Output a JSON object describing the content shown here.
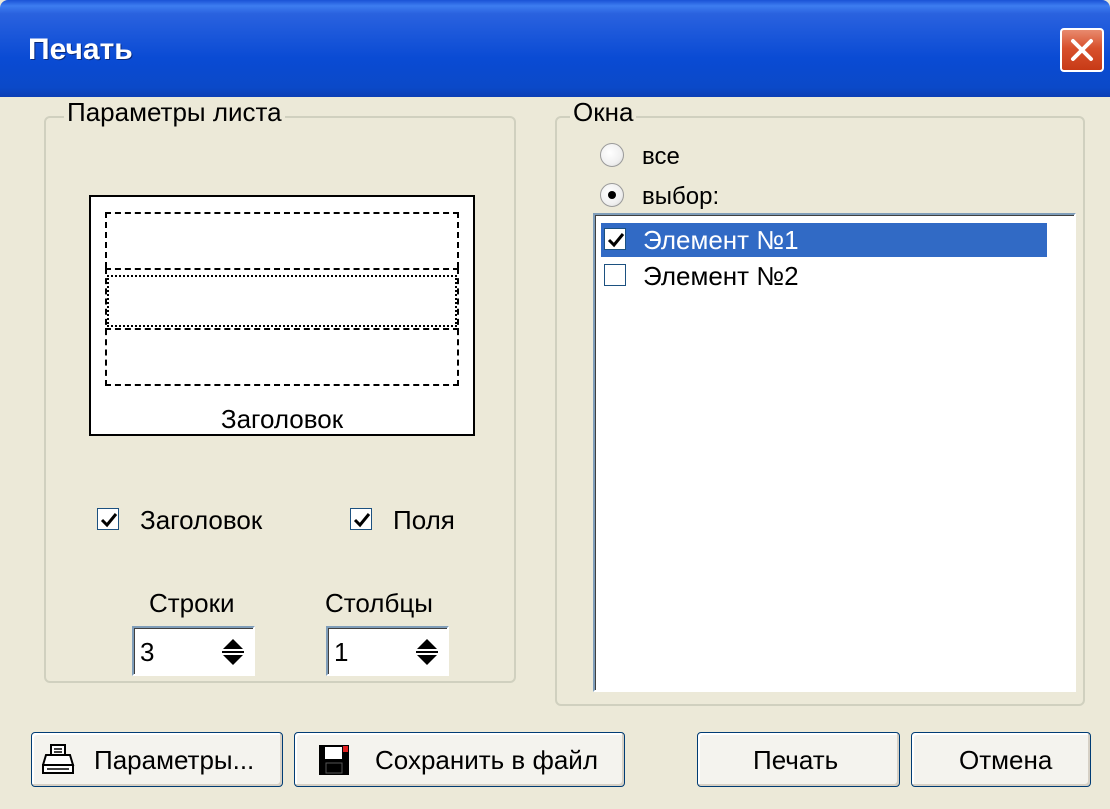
{
  "window": {
    "title": "Печать"
  },
  "sheet_params": {
    "group_label": "Параметры листа",
    "preview_caption": "Заголовок",
    "header_checkbox": {
      "label": "Заголовок",
      "checked": true
    },
    "margins_checkbox": {
      "label": "Поля",
      "checked": true
    },
    "rows": {
      "label": "Строки",
      "value": "3"
    },
    "columns": {
      "label": "Столбцы",
      "value": "1"
    }
  },
  "windows": {
    "group_label": "Окна",
    "radio_all": {
      "label": "все",
      "selected": false
    },
    "radio_selection": {
      "label": "выбор:",
      "selected": true
    },
    "items": [
      {
        "label": "Элемент №1",
        "checked": true,
        "selected": true
      },
      {
        "label": "Элемент №2",
        "checked": false,
        "selected": false
      }
    ]
  },
  "buttons": {
    "params": "Параметры...",
    "save": "Сохранить в файл",
    "print": "Печать",
    "cancel": "Отмена"
  },
  "icons": {
    "close": "close-icon",
    "printer": "printer-icon",
    "floppy": "floppy-disk-icon"
  },
  "colors": {
    "titlebar": "#0a4bd4",
    "dialog_bg": "#ece9d8",
    "selection": "#316ac5",
    "close_button": "#d8512d"
  }
}
